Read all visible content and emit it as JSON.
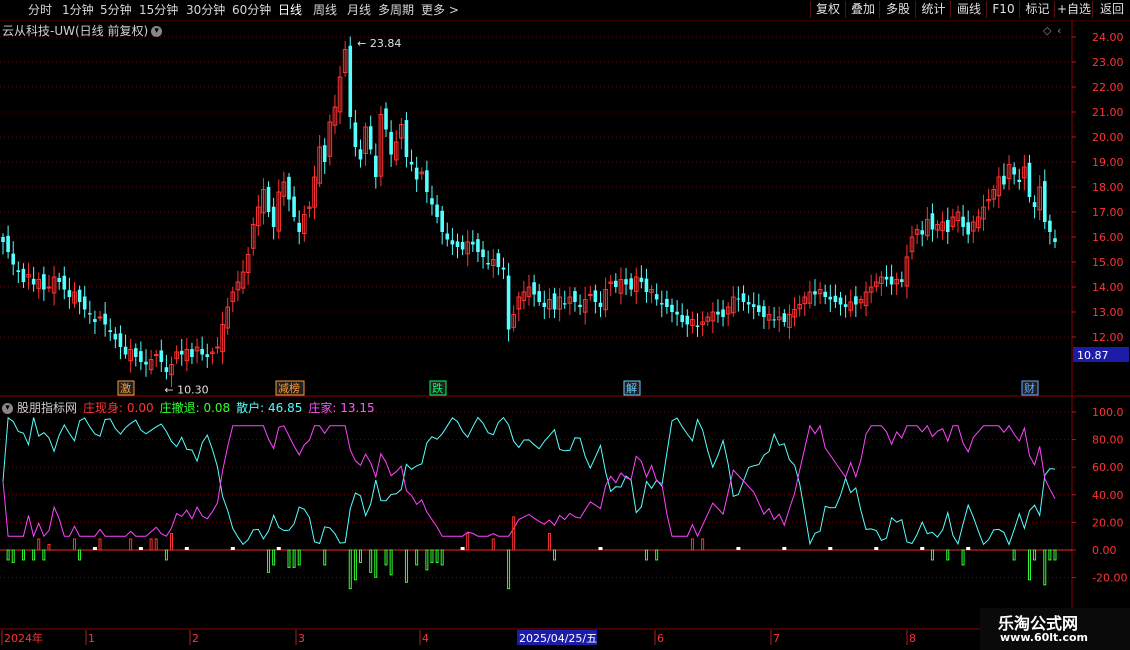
{
  "toolbar": {
    "timeframes": [
      "分时",
      "1分钟",
      "5分钟",
      "15分钟",
      "30分钟",
      "60分钟",
      "日线",
      "周线",
      "月线",
      "多周期",
      "更多 >"
    ],
    "active_timeframe": "日线",
    "right_buttons": [
      "复权",
      "叠加",
      "多股",
      "统计",
      "画线",
      "F10",
      "标记",
      "+自选",
      "返回"
    ]
  },
  "stock": {
    "title": "云从科技-UW(日线 前复权)",
    "dropdown_icon": "chevron-down-icon"
  },
  "price_axis": {
    "ticks": [
      "24.00",
      "23.00",
      "22.00",
      "21.00",
      "20.00",
      "19.00",
      "18.00",
      "17.00",
      "16.00",
      "15.00",
      "14.00",
      "13.00",
      "12.00"
    ],
    "current_price": "10.87",
    "current_price_bg": "#1c1ca8"
  },
  "annotations": {
    "high_label": "23.84",
    "low_label": "10.30",
    "tags": [
      {
        "text": "激",
        "color": "#ff9933"
      },
      {
        "text": "减榜",
        "color": "#ff9933"
      },
      {
        "text": "跌",
        "color": "#00ff66"
      },
      {
        "text": "解",
        "color": "#66ccff"
      },
      {
        "text": "财",
        "color": "#66aaff"
      }
    ]
  },
  "indicator": {
    "name": "股朋指标网",
    "items": [
      {
        "label": "庄现身: 0.00",
        "color": "#ff3333"
      },
      {
        "label": "庄撤退: 0.08",
        "color": "#33ff33"
      },
      {
        "label": "散户: 46.85",
        "color": "#55ffff"
      },
      {
        "label": "庄家: 13.15",
        "color": "#ff55ff"
      }
    ],
    "axis_ticks": [
      "100.0",
      "80.00",
      "60.00",
      "40.00",
      "20.00",
      "0.00",
      "-20.00"
    ]
  },
  "date_axis": {
    "labels": [
      "2024年",
      "1",
      "2",
      "3",
      "4",
      "6",
      "7",
      "8"
    ],
    "cursor_date": "2025/04/25/五"
  },
  "watermark": {
    "name": "乐淘公式网",
    "url": "www.60lt.com"
  },
  "colors": {
    "up": "#ff3333",
    "down": "#55ffff",
    "sanhu": "#55ffff",
    "zhuangjia": "#ff44ff",
    "grid": "#6a0000"
  },
  "chart_data": {
    "type": "candlestick",
    "ylim": [
      10.0,
      24.2
    ],
    "high": 23.84,
    "low": 10.3,
    "close_series": [
      15.8,
      15.4,
      14.9,
      14.6,
      14.2,
      14.5,
      14.1,
      14.3,
      13.9,
      14.0,
      14.4,
      14.2,
      13.9,
      13.6,
      13.8,
      13.4,
      13.1,
      12.9,
      12.6,
      12.8,
      12.5,
      12.2,
      11.9,
      11.6,
      11.3,
      11.5,
      11.2,
      11.0,
      10.9,
      11.1,
      11.3,
      11.0,
      10.6,
      10.9,
      11.4,
      11.3,
      11.5,
      11.2,
      11.6,
      11.3,
      11.2,
      11.4,
      11.6,
      12.5,
      13.2,
      13.8,
      14.2,
      14.6,
      15.3,
      16.5,
      17.2,
      17.9,
      17.0,
      16.4,
      17.8,
      18.2,
      17.5,
      16.8,
      16.2,
      16.9,
      17.2,
      18.4,
      19.6,
      19.0,
      20.6,
      21.2,
      22.4,
      23.5,
      20.8,
      19.6,
      19.1,
      20.4,
      19.5,
      18.4,
      20.9,
      20.3,
      19.3,
      19.8,
      20.5,
      19.2,
      18.9,
      18.3,
      18.6,
      17.8,
      17.3,
      16.8,
      16.2,
      15.9,
      15.7,
      15.6,
      15.5,
      15.8,
      15.7,
      15.4,
      15.2,
      14.9,
      15.1,
      14.8,
      14.7,
      12.3,
      12.9,
      13.6,
      13.8,
      14.0,
      13.7,
      13.4,
      13.2,
      13.5,
      13.1,
      13.6,
      13.3,
      13.6,
      13.4,
      13.2,
      13.5,
      13.7,
      13.4,
      13.2,
      13.9,
      14.2,
      14.0,
      14.3,
      14.1,
      13.9,
      14.4,
      14.2,
      13.8,
      13.9,
      13.5,
      13.3,
      13.2,
      13.0,
      12.9,
      12.6,
      12.5,
      12.7,
      12.4,
      12.6,
      12.8,
      13.0,
      12.9,
      12.8,
      13.2,
      13.6,
      13.5,
      13.4,
      13.3,
      13.2,
      13.0,
      12.8,
      12.9,
      12.7,
      12.8,
      12.6,
      12.9,
      13.1,
      13.3,
      13.6,
      13.8,
      13.7,
      13.9,
      13.6,
      13.5,
      13.4,
      13.3,
      13.2,
      13.4,
      13.3,
      13.5,
      13.8,
      14.0,
      14.2,
      14.4,
      14.3,
      14.1,
      14.3,
      14.2,
      15.2,
      16.0,
      16.3,
      16.1,
      16.7,
      16.3,
      16.5,
      16.6,
      16.2,
      16.8,
      17.0,
      16.4,
      16.1,
      16.6,
      16.8,
      17.2,
      17.5,
      17.9,
      18.4,
      18.1,
      18.9,
      18.5,
      18.2,
      18.8,
      17.6,
      17.2,
      18.0,
      16.6,
      16.2,
      15.8
    ]
  }
}
